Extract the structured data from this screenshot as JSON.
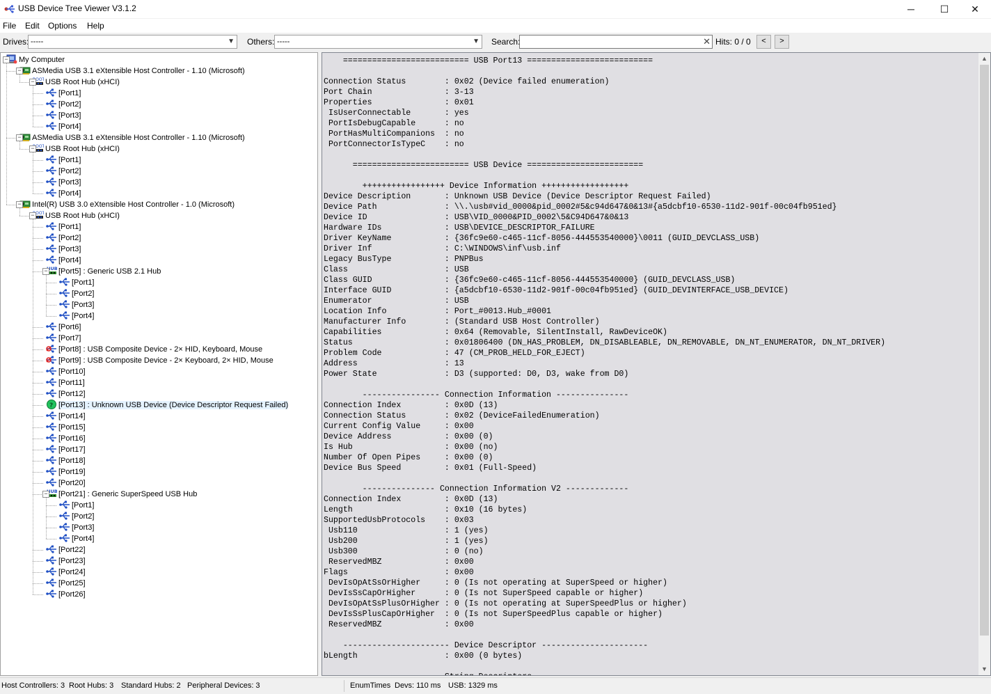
{
  "window": {
    "title": "USB Device Tree Viewer V3.1.2",
    "minimize": "─",
    "maximize": "☐",
    "close": "✕"
  },
  "menu": [
    "File",
    "Edit",
    "Options",
    "Help"
  ],
  "toolbar": {
    "drives_label": "Drives:",
    "drives_value": "-----",
    "others_label": "Others:",
    "others_value": "-----",
    "search_label": "Search:",
    "search_value": "",
    "search_clear": "✕",
    "hits_label": "Hits: 0 / 0",
    "prev": "<",
    "next": ">"
  },
  "tree": [
    {
      "label": "My Computer",
      "icon": "computer-icon",
      "depth": 0
    },
    {
      "label": "ASMedia USB 3.1 eXtensible Host Controller - 1.10 (Microsoft)",
      "icon": "host-controller-icon",
      "depth": 1
    },
    {
      "label": "USB Root Hub (xHCI)",
      "icon": "root-hub-icon",
      "depth": 2
    },
    {
      "label": "[Port1]",
      "icon": "usb-port-icon",
      "depth": 3
    },
    {
      "label": "[Port2]",
      "icon": "usb-port-icon",
      "depth": 3
    },
    {
      "label": "[Port3]",
      "icon": "usb-port-icon",
      "depth": 3
    },
    {
      "label": "[Port4]",
      "icon": "usb-port-icon",
      "depth": 3
    },
    {
      "label": "ASMedia USB 3.1 eXtensible Host Controller - 1.10 (Microsoft)",
      "icon": "host-controller-icon",
      "depth": 1
    },
    {
      "label": "USB Root Hub (xHCI)",
      "icon": "root-hub-icon",
      "depth": 2
    },
    {
      "label": "[Port1]",
      "icon": "usb-port-icon",
      "depth": 3
    },
    {
      "label": "[Port2]",
      "icon": "usb-port-icon",
      "depth": 3
    },
    {
      "label": "[Port3]",
      "icon": "usb-port-icon",
      "depth": 3
    },
    {
      "label": "[Port4]",
      "icon": "usb-port-icon",
      "depth": 3
    },
    {
      "label": "Intel(R) USB 3.0 eXtensible Host Controller - 1.0 (Microsoft)",
      "icon": "host-controller-icon",
      "depth": 1
    },
    {
      "label": "USB Root Hub (xHCI)",
      "icon": "root-hub-icon",
      "depth": 2
    },
    {
      "label": "[Port1]",
      "icon": "usb-port-icon",
      "depth": 3
    },
    {
      "label": "[Port2]",
      "icon": "usb-port-icon",
      "depth": 3
    },
    {
      "label": "[Port3]",
      "icon": "usb-port-icon",
      "depth": 3
    },
    {
      "label": "[Port4]",
      "icon": "usb-port-icon",
      "depth": 3
    },
    {
      "label": "[Port5] : Generic USB 2.1 Hub",
      "icon": "hub-icon",
      "depth": 3
    },
    {
      "label": "[Port1]",
      "icon": "usb-port-icon",
      "depth": 4
    },
    {
      "label": "[Port2]",
      "icon": "usb-port-icon",
      "depth": 4
    },
    {
      "label": "[Port3]",
      "icon": "usb-port-icon",
      "depth": 4
    },
    {
      "label": "[Port4]",
      "icon": "usb-port-icon",
      "depth": 4
    },
    {
      "label": "[Port6]",
      "icon": "usb-port-icon",
      "depth": 3
    },
    {
      "label": "[Port7]",
      "icon": "usb-port-icon",
      "depth": 3
    },
    {
      "label": "[Port8] : USB Composite Device - 2× HID, Keyboard, Mouse",
      "icon": "usb-device-icon",
      "depth": 3
    },
    {
      "label": "[Port9] : USB Composite Device - 2× Keyboard, 2× HID, Mouse",
      "icon": "usb-device-icon",
      "depth": 3
    },
    {
      "label": "[Port10]",
      "icon": "usb-port-icon",
      "depth": 3
    },
    {
      "label": "[Port11]",
      "icon": "usb-port-icon",
      "depth": 3
    },
    {
      "label": "[Port12]",
      "icon": "usb-port-icon",
      "depth": 3
    },
    {
      "label": "[Port13] : Unknown USB Device (Device Descriptor Request Failed)",
      "icon": "unknown-device-icon",
      "depth": 3,
      "selected": true
    },
    {
      "label": "[Port14]",
      "icon": "usb-port-icon",
      "depth": 3
    },
    {
      "label": "[Port15]",
      "icon": "usb-port-icon",
      "depth": 3
    },
    {
      "label": "[Port16]",
      "icon": "usb-port-icon",
      "depth": 3
    },
    {
      "label": "[Port17]",
      "icon": "usb-port-icon",
      "depth": 3
    },
    {
      "label": "[Port18]",
      "icon": "usb-port-icon",
      "depth": 3
    },
    {
      "label": "[Port19]",
      "icon": "usb-port-icon",
      "depth": 3
    },
    {
      "label": "[Port20]",
      "icon": "usb-port-icon",
      "depth": 3
    },
    {
      "label": "[Port21] : Generic SuperSpeed USB Hub",
      "icon": "hub-icon",
      "depth": 3
    },
    {
      "label": "[Port1]",
      "icon": "usb-port-icon",
      "depth": 4
    },
    {
      "label": "[Port2]",
      "icon": "usb-port-icon",
      "depth": 4
    },
    {
      "label": "[Port3]",
      "icon": "usb-port-icon",
      "depth": 4
    },
    {
      "label": "[Port4]",
      "icon": "usb-port-icon",
      "depth": 4
    },
    {
      "label": "[Port22]",
      "icon": "usb-port-icon",
      "depth": 3
    },
    {
      "label": "[Port23]",
      "icon": "usb-port-icon",
      "depth": 3
    },
    {
      "label": "[Port24]",
      "icon": "usb-port-icon",
      "depth": 3
    },
    {
      "label": "[Port25]",
      "icon": "usb-port-icon",
      "depth": 3
    },
    {
      "label": "[Port26]",
      "icon": "usb-port-icon",
      "depth": 3
    }
  ],
  "details": [
    "    ========================== USB Port13 ==========================",
    "",
    "Connection Status        : 0x02 (Device failed enumeration)",
    "Port Chain               : 3-13",
    "Properties               : 0x01",
    " IsUserConnectable       : yes",
    " PortIsDebugCapable      : no",
    " PortHasMultiCompanions  : no",
    " PortConnectorIsTypeC    : no",
    "",
    "      ======================== USB Device ========================",
    "",
    "        +++++++++++++++++ Device Information ++++++++++++++++++",
    "Device Description       : Unknown USB Device (Device Descriptor Request Failed)",
    "Device Path              : \\\\.\\usb#vid_0000&pid_0002#5&c94d647&0&13#{a5dcbf10-6530-11d2-901f-00c04fb951ed}",
    "Device ID                : USB\\VID_0000&PID_0002\\5&C94D647&0&13",
    "Hardware IDs             : USB\\DEVICE_DESCRIPTOR_FAILURE",
    "Driver KeyName           : {36fc9e60-c465-11cf-8056-444553540000}\\0011 (GUID_DEVCLASS_USB)",
    "Driver Inf               : C:\\WINDOWS\\inf\\usb.inf",
    "Legacy BusType           : PNPBus",
    "Class                    : USB",
    "Class GUID               : {36fc9e60-c465-11cf-8056-444553540000} (GUID_DEVCLASS_USB)",
    "Interface GUID           : {a5dcbf10-6530-11d2-901f-00c04fb951ed} (GUID_DEVINTERFACE_USB_DEVICE)",
    "Enumerator               : USB",
    "Location Info            : Port_#0013.Hub_#0001",
    "Manufacturer Info        : (Standard USB Host Controller)",
    "Capabilities             : 0x64 (Removable, SilentInstall, RawDeviceOK)",
    "Status                   : 0x01806400 (DN_HAS_PROBLEM, DN_DISABLEABLE, DN_REMOVABLE, DN_NT_ENUMERATOR, DN_NT_DRIVER)",
    "Problem Code             : 47 (CM_PROB_HELD_FOR_EJECT)",
    "Address                  : 13",
    "Power State              : D3 (supported: D0, D3, wake from D0)",
    "",
    "        ---------------- Connection Information ---------------",
    "Connection Index         : 0x0D (13)",
    "Connection Status        : 0x02 (DeviceFailedEnumeration)",
    "Current Config Value     : 0x00",
    "Device Address           : 0x00 (0)",
    "Is Hub                   : 0x00 (no)",
    "Number Of Open Pipes     : 0x00 (0)",
    "Device Bus Speed         : 0x01 (Full-Speed)",
    "",
    "        --------------- Connection Information V2 -------------",
    "Connection Index         : 0x0D (13)",
    "Length                   : 0x10 (16 bytes)",
    "SupportedUsbProtocols    : 0x03",
    " Usb110                  : 1 (yes)",
    " Usb200                  : 1 (yes)",
    " Usb300                  : 0 (no)",
    " ReservedMBZ             : 0x00",
    "Flags                    : 0x00",
    " DevIsOpAtSsOrHigher     : 0 (Is not operating at SuperSpeed or higher)",
    " DevIsSsCapOrHigher      : 0 (Is not SuperSpeed capable or higher)",
    " DevIsOpAtSsPlusOrHigher : 0 (Is not operating at SuperSpeedPlus or higher)",
    " DevIsSsPlusCapOrHigher  : 0 (Is not SuperSpeedPlus capable or higher)",
    " ReservedMBZ             : 0x00",
    "",
    "    ---------------------- Device Descriptor ----------------------",
    "bLength                  : 0x00 (0 bytes)",
    "",
    "        ---------------- String Descriptors ---------------"
  ],
  "status": {
    "host_controllers": "Host Controllers: 3",
    "root_hubs": "Root Hubs: 3",
    "standard_hubs": "Standard Hubs: 2",
    "peripheral_devices": "Peripheral Devices: 3",
    "enum_times": "EnumTimes",
    "devs": "Devs: 110 ms",
    "usb": "USB: 1329 ms"
  },
  "colors": {
    "details_background": "#e0dfe3",
    "selection": "#e5f3ff",
    "unknown_device": "#22c35e",
    "usb_port_blue": "#1f4fc4",
    "controller_green": "#2f8f3a"
  }
}
